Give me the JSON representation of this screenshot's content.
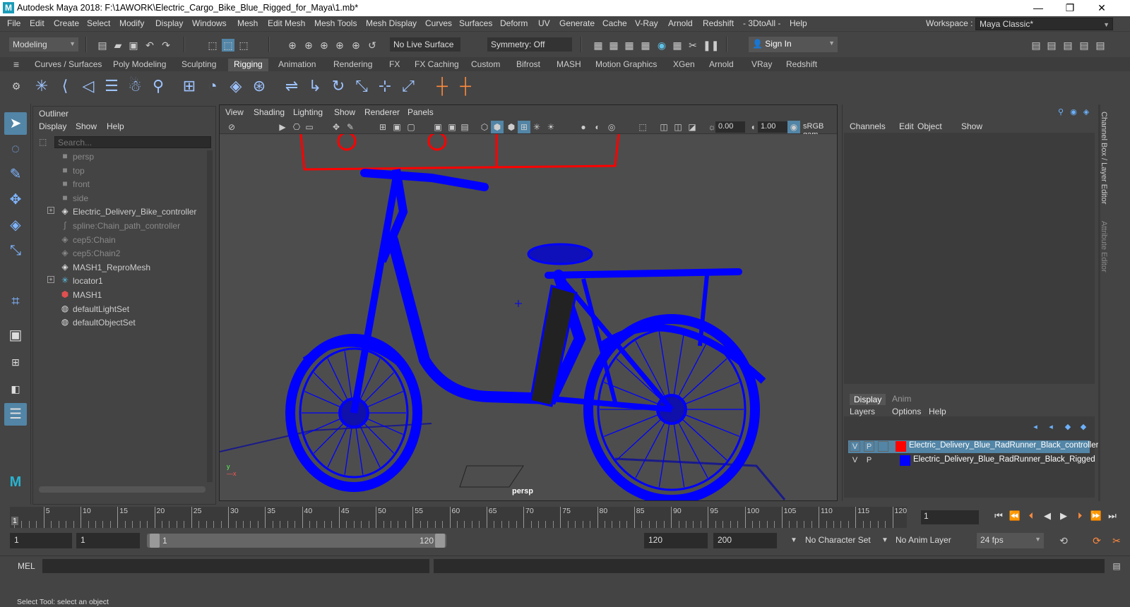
{
  "window": {
    "app_icon": "M",
    "title": "Autodesk Maya 2018: F:\\1AWORK\\Electric_Cargo_Bike_Blue_Rigged_for_Maya\\1.mb*",
    "minimize": "—",
    "restore": "❐",
    "close": "✕"
  },
  "menubar": {
    "items": [
      "File",
      "Edit",
      "Create",
      "Select",
      "Modify",
      "Display",
      "Windows",
      "Mesh",
      "Edit Mesh",
      "Mesh Tools",
      "Mesh Display",
      "Curves",
      "Surfaces",
      "Deform",
      "UV",
      "Generate",
      "Cache",
      "V-Ray",
      "Arnold",
      "Redshift",
      "- 3DtoAll -",
      "Help"
    ],
    "workspace_label": "Workspace :",
    "workspace_value": "Maya Classic*"
  },
  "statusline": {
    "menuset": "Modeling",
    "live_surface": "No Live Surface",
    "symmetry": "Symmetry: Off",
    "sign_in": "Sign In"
  },
  "shelf": {
    "tabs": [
      "Curves / Surfaces",
      "Poly Modeling",
      "Sculpting",
      "Rigging",
      "Animation",
      "Rendering",
      "FX",
      "FX Caching",
      "Custom",
      "Bifrost",
      "MASH",
      "Motion Graphics",
      "XGen",
      "Arnold",
      "VRay",
      "Redshift"
    ],
    "active_tab": "Rigging"
  },
  "outliner": {
    "title": "Outliner",
    "menus": [
      "Display",
      "Show",
      "Help"
    ],
    "search_placeholder": "Search...",
    "items": [
      {
        "label": "persp",
        "icon": "camera-icon",
        "dim": true,
        "expandable": false
      },
      {
        "label": "top",
        "icon": "camera-icon",
        "dim": true,
        "expandable": false
      },
      {
        "label": "front",
        "icon": "camera-icon",
        "dim": true,
        "expandable": false
      },
      {
        "label": "side",
        "icon": "camera-icon",
        "dim": true,
        "expandable": false
      },
      {
        "label": "Electric_Delivery_Bike_controller",
        "icon": "transform-icon",
        "dim": false,
        "expandable": true
      },
      {
        "label": "spline:Chain_path_controller",
        "icon": "curve-icon",
        "dim": true,
        "expandable": false
      },
      {
        "label": "cep5:Chain",
        "icon": "transform-icon",
        "dim": true,
        "expandable": false
      },
      {
        "label": "cep5:Chain2",
        "icon": "transform-icon",
        "dim": true,
        "expandable": false
      },
      {
        "label": "MASH1_ReproMesh",
        "icon": "transform-icon",
        "dim": false,
        "expandable": false
      },
      {
        "label": "locator1",
        "icon": "locator-icon",
        "dim": false,
        "expandable": true
      },
      {
        "label": "MASH1",
        "icon": "mash-icon",
        "dim": false,
        "expandable": false
      },
      {
        "label": "defaultLightSet",
        "icon": "set-icon",
        "dim": false,
        "expandable": false
      },
      {
        "label": "defaultObjectSet",
        "icon": "set-icon",
        "dim": false,
        "expandable": false
      }
    ]
  },
  "viewport": {
    "menus": [
      "View",
      "Shading",
      "Lighting",
      "Show",
      "Renderer",
      "Panels"
    ],
    "exposure": "0.00",
    "gamma": "1.00",
    "color_space": "sRGB gam",
    "camera_label": "persp",
    "wire_color": "#0000ff",
    "controller_color": "#ff0000"
  },
  "channelbox": {
    "menus": [
      "Channels",
      "Edit",
      "Object",
      "Show"
    ],
    "tab_labels": [
      "Channel Box / Layer Editor",
      "Attribute Editor"
    ],
    "layer_tabs": [
      "Display",
      "Anim"
    ],
    "layer_menus": [
      "Layers",
      "Options",
      "Help"
    ],
    "layers": [
      {
        "v": "V",
        "p": "P",
        "color": "#ff0000",
        "name": "Electric_Delivery_Blue_RadRunner_Black_controllers",
        "selected": true
      },
      {
        "v": "V",
        "p": "P",
        "color": "#0000ff",
        "name": "Electric_Delivery_Blue_RadRunner_Black_Rigged",
        "selected": false
      }
    ]
  },
  "timeslider": {
    "ticks": [
      5,
      10,
      15,
      20,
      25,
      30,
      35,
      40,
      45,
      50,
      55,
      60,
      65,
      70,
      75,
      80,
      85,
      90,
      95,
      100,
      105,
      110,
      115,
      120
    ],
    "current_frame_marker": "1",
    "current_frame": "1"
  },
  "range": {
    "start": "1",
    "playback_start": "1",
    "slider_start": "1",
    "slider_end": "120",
    "playback_end": "120",
    "end": "200",
    "character_set": "No Character Set",
    "anim_layer": "No Anim Layer",
    "fps": "24 fps"
  },
  "command": {
    "label": "MEL"
  },
  "help_line": "Select Tool: select an object"
}
